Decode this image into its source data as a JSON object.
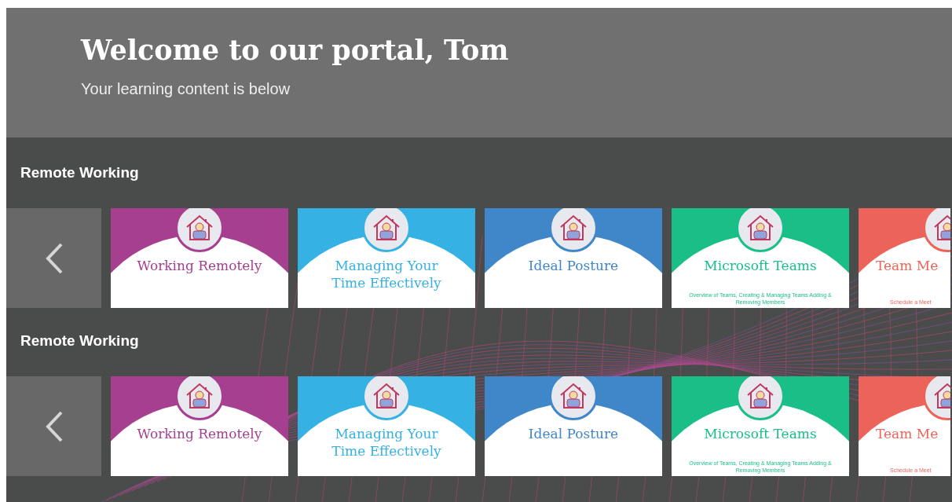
{
  "header": {
    "title": "Welcome to our portal, Tom",
    "subtitle": "Your learning content is below"
  },
  "sections": [
    {
      "title": "Remote Working",
      "cards": [
        {
          "kind": "full",
          "color": "#a63f90",
          "title": "Working Remotely"
        },
        {
          "kind": "full",
          "color": "#36b1e4",
          "title": "Managing Your Time Effectively"
        },
        {
          "kind": "full",
          "color": "#3f87c9",
          "title": "Ideal Posture"
        },
        {
          "kind": "full",
          "color": "#19bf86",
          "title": "Microsoft Teams",
          "subtitle": "Overview of Teams, Creating & Managing Teams Adding & Removing Members"
        },
        {
          "kind": "partial",
          "color": "#ec6459",
          "title": "Team Me",
          "subtitle": "Schedule a Meet"
        }
      ]
    },
    {
      "title": "Remote Working",
      "cards": [
        {
          "kind": "full",
          "color": "#a63f90",
          "title": "Working Remotely"
        },
        {
          "kind": "full",
          "color": "#36b1e4",
          "title": "Managing Your Time Effectively"
        },
        {
          "kind": "full",
          "color": "#3f87c9",
          "title": "Ideal Posture"
        },
        {
          "kind": "full",
          "color": "#19bf86",
          "title": "Microsoft Teams",
          "subtitle": "Overview of Teams, Creating & Managing Teams Adding & Removing Members"
        },
        {
          "kind": "partial",
          "color": "#ec6459",
          "title": "Team Me",
          "subtitle": "Schedule a Meet"
        }
      ]
    }
  ]
}
